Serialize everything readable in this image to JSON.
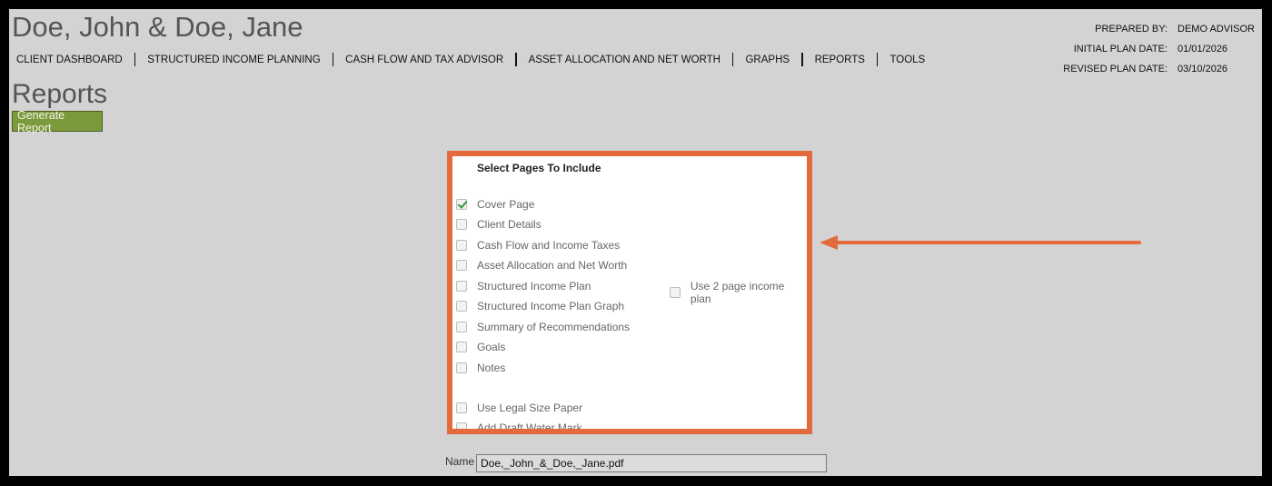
{
  "header": {
    "client_name": "Doe, John & Doe, Jane",
    "nav": [
      "CLIENT DASHBOARD",
      "STRUCTURED INCOME PLANNING",
      "CASH FLOW AND TAX ADVISOR",
      "ASSET ALLOCATION AND NET WORTH",
      "GRAPHS",
      "REPORTS",
      "TOOLS"
    ],
    "meta": {
      "prepared_by_label": "PREPARED BY:",
      "prepared_by_value": "DEMO ADVISOR",
      "initial_label": "INITIAL PLAN DATE:",
      "initial_value": "01/01/2026",
      "revised_label": "REVISED PLAN DATE:",
      "revised_value": "03/10/2026"
    }
  },
  "main": {
    "title": "Reports",
    "generate_button": "Generate Report",
    "panel": {
      "title": "Select Pages To Include",
      "options": [
        {
          "label": "Cover Page",
          "checked": true
        },
        {
          "label": "Client Details",
          "checked": false
        },
        {
          "label": "Cash Flow and Income Taxes",
          "checked": false
        },
        {
          "label": "Asset Allocation and Net Worth",
          "checked": false
        },
        {
          "label": "Structured Income Plan",
          "checked": false
        },
        {
          "label": "Structured Income Plan Graph",
          "checked": false
        },
        {
          "label": "Summary of Recommendations",
          "checked": false
        },
        {
          "label": "Goals",
          "checked": false
        },
        {
          "label": "Notes",
          "checked": false
        }
      ],
      "two_page_option": {
        "label": "Use 2 page income plan",
        "checked": false
      },
      "extra_options": [
        {
          "label": "Use Legal Size Paper",
          "checked": false
        },
        {
          "label": "Add Draft Water Mark",
          "checked": false
        }
      ]
    },
    "name_label": "Name",
    "name_value": "Doe,_John_&_Doe,_Jane.pdf"
  },
  "colors": {
    "background": "#d3d3d3",
    "highlight_border": "#e36a3c",
    "button": "#7b9a3b"
  }
}
